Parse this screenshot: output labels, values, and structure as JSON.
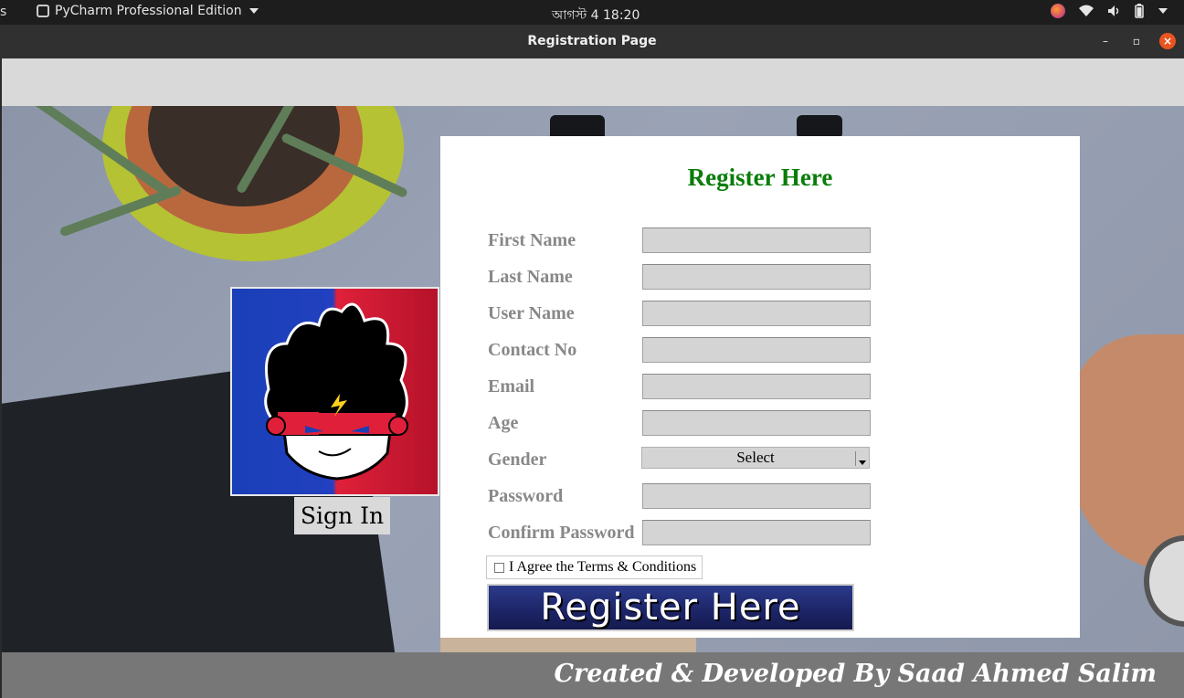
{
  "topbar": {
    "edge_char": "s",
    "app_name": "PyCharm Professional Edition",
    "clock": "আগস্ট 4  18:20"
  },
  "window": {
    "title": "Registration Page",
    "minimize": "–",
    "maximize": "▫",
    "close": "×"
  },
  "sidebar": {
    "signin_label": "Sign In"
  },
  "form": {
    "heading": "Register Here",
    "fields": [
      {
        "label": "First Name",
        "value": ""
      },
      {
        "label": "Last Name",
        "value": ""
      },
      {
        "label": "User Name",
        "value": ""
      },
      {
        "label": "Contact No",
        "value": ""
      },
      {
        "label": "Email",
        "value": ""
      },
      {
        "label": "Age",
        "value": ""
      },
      {
        "label": "Gender",
        "value": "Select"
      },
      {
        "label": "Password",
        "value": ""
      },
      {
        "label": "Confirm Password",
        "value": ""
      }
    ],
    "agree_label": "I Agree the Terms & Conditions",
    "agree_checked": false,
    "register_label": "Register Here"
  },
  "footer": {
    "credit": "Created & Developed By Saad Ahmed Salim"
  },
  "colors": {
    "heading": "#0a7d0a",
    "label": "#888888",
    "register_button": "#1c2466",
    "footer": "#777777",
    "close_button": "#e95420"
  },
  "icons": [
    "pycharm-app-icon",
    "firefox-icon",
    "wifi-icon",
    "volume-icon",
    "battery-icon",
    "system-menu-chevron-icon"
  ]
}
